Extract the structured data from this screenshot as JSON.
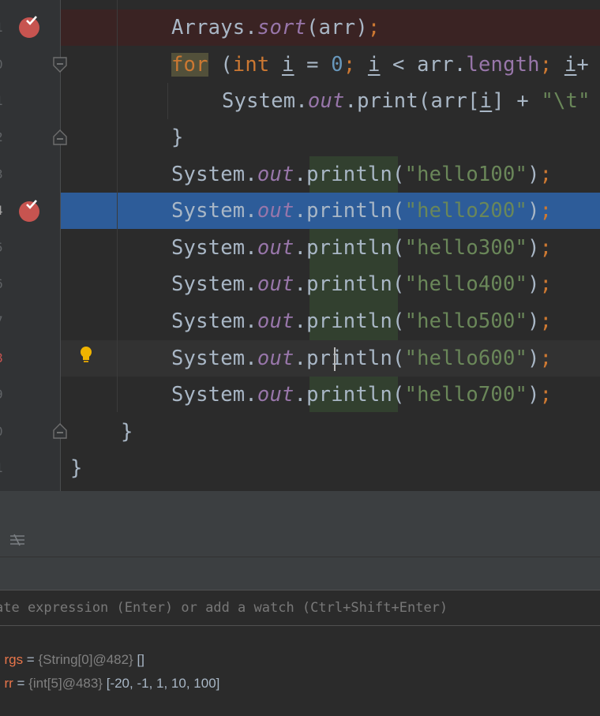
{
  "editor": {
    "lines": {
      "sort": {
        "obj": "Arrays",
        "method": "sort",
        "arg": "arr",
        "semi": ";"
      },
      "for": {
        "kw": "for",
        "open": " (",
        "type": "int",
        "var": "i",
        "eq": " = ",
        "zero": "0",
        "semi1": ";",
        "var2": "i",
        "lt": " < ",
        "arr": "arr",
        "dot": ".",
        "len": "length",
        "semi2": ";",
        "var3": "i",
        "rest": "+"
      },
      "print": {
        "obj": "System",
        "dot1": ".",
        "out": "out",
        "dot2": ".",
        "method": "print",
        "open": "(arr[",
        "var": "i",
        "close": "] + ",
        "str": "\"\\t\""
      },
      "close_brace": "}",
      "println_rows": [
        {
          "obj": "System",
          "out": "out",
          "method": "println",
          "str": "\"hello100\""
        },
        {
          "obj": "System",
          "out": "out",
          "method": "println",
          "str": "\"hello200\""
        },
        {
          "obj": "System",
          "out": "out",
          "method": "println",
          "str": "\"hello300\""
        },
        {
          "obj": "System",
          "out": "out",
          "method": "println",
          "str": "\"hello400\""
        },
        {
          "obj": "System",
          "out": "out",
          "method": "println",
          "str": "\"hello500\""
        },
        {
          "obj": "System",
          "out": "out",
          "method": "println",
          "str": "\"hello600\""
        },
        {
          "obj": "System",
          "out": "out",
          "method": "println",
          "str": "\"hello700\""
        }
      ],
      "method_close": "}",
      "class_close": "}"
    },
    "gutter_numbers": [
      "1",
      "0",
      "1",
      "2",
      "3",
      "4",
      "5",
      "6",
      "7",
      "8",
      "9",
      "0",
      "1"
    ],
    "colors": {
      "background": "#2b2b2b",
      "keyword": "#cc7832",
      "string": "#6a8759",
      "static_field": "#9876aa",
      "number": "#6897bb",
      "execution_line": "#2d5c99",
      "breakpoint": "#c75450"
    }
  },
  "debugger": {
    "watch_placeholder": "ate expression (Enter) or add a watch (Ctrl+Shift+Enter)",
    "variables": [
      {
        "name": "rgs",
        "eq": " = ",
        "type": "{String[0]@482}",
        "value": " []"
      },
      {
        "name": "rr",
        "eq": " = ",
        "type": "{int[5]@483}",
        "value": " [-20, -1, 1, 10, 100]"
      }
    ],
    "toolbar_icon": "restore-layout-icon"
  }
}
